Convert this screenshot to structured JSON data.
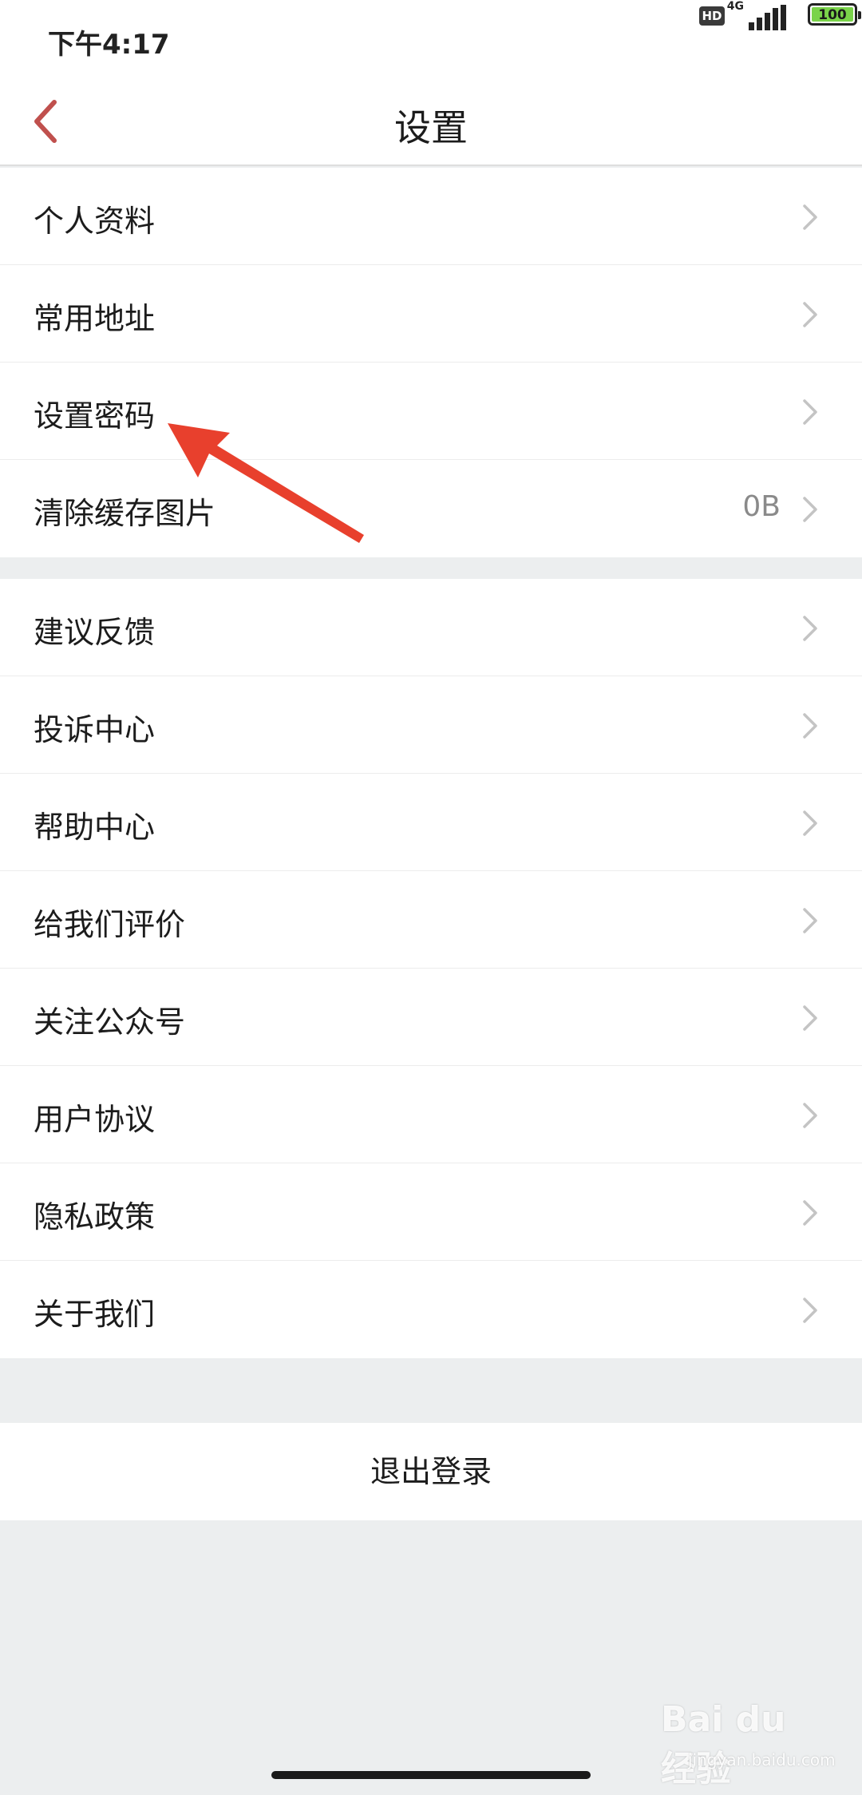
{
  "status_bar": {
    "time": "下午4:17",
    "hd_badge": "HD",
    "network": "4G",
    "battery_level": "100",
    "battery_color": "#7ad34a"
  },
  "header": {
    "title": "设置",
    "back_icon": "chevron-left-icon",
    "accent_color": "#c0504d"
  },
  "settings": {
    "group1": [
      {
        "label": "个人资料",
        "value": ""
      },
      {
        "label": "常用地址",
        "value": ""
      },
      {
        "label": "设置密码",
        "value": ""
      },
      {
        "label": "清除缓存图片",
        "value": "0B"
      }
    ],
    "group2": [
      {
        "label": "建议反馈"
      },
      {
        "label": "投诉中心"
      },
      {
        "label": "帮助中心"
      },
      {
        "label": "给我们评价"
      },
      {
        "label": "关注公众号"
      },
      {
        "label": "用户协议"
      },
      {
        "label": "隐私政策"
      },
      {
        "label": "关于我们"
      }
    ]
  },
  "logout": {
    "label": "退出登录"
  },
  "annotation": {
    "color": "#e8402d"
  },
  "watermark": {
    "text": "Bai du 经验",
    "sub": "jingyan.baidu.com"
  }
}
